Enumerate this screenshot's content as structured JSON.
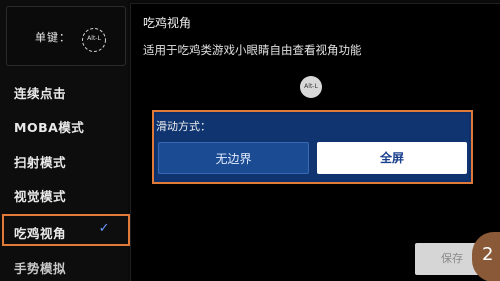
{
  "left_panel": {
    "single_key_label": "单键：",
    "key_badge": "Alt-L",
    "menu": [
      {
        "label": "连续点击"
      },
      {
        "label": "MOBA模式"
      },
      {
        "label": "扫射模式"
      },
      {
        "label": "视觉模式"
      },
      {
        "label": "吃鸡视角",
        "selected": true
      },
      {
        "label": "手势模拟"
      }
    ],
    "check_icon": "✓"
  },
  "right_panel": {
    "title": "吃鸡视角",
    "description": "适用于吃鸡类游戏小眼睛自由查看视角功能",
    "key_badge": "Alt-L",
    "slide_section": {
      "label": "滑动方式：",
      "options": [
        {
          "label": "无边界",
          "selected": false
        },
        {
          "label": "全屏",
          "selected": true
        }
      ]
    },
    "save_label": "保存",
    "step_badge": "2"
  },
  "colors": {
    "highlight_orange": "#e07a38",
    "panel_blue": "#0f3470",
    "option_blue": "#1b4b93",
    "check_blue": "#6a9cff"
  }
}
